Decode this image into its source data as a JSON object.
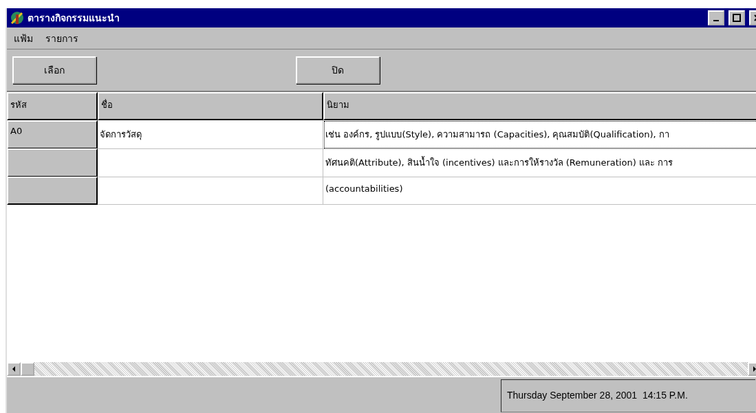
{
  "window": {
    "title": "ตารางกิจกรรมแนะนำ"
  },
  "menu": [
    "แฟ้ม",
    "รายการ"
  ],
  "buttons": [
    "เลือก",
    "ปิด"
  ],
  "table": {
    "columns": [
      "รหัส",
      "ชื่อ",
      "นิยาม"
    ],
    "rows": [
      {
        "code": "A0",
        "name": "จัดการวัสดุ",
        "definition": "เช่น องค์กร, รูปแบบ(Style), ความสามารถ (Capacities), คุณสมบัติ(Qualification), กา",
        "focused": true
      },
      {
        "code": "",
        "name": "",
        "definition": "ทัศนคติ(Attribute), สินน้ำใจ (incentives) และการให้รางวัล (Remuneration) และ การ",
        "focused": false
      },
      {
        "code": "",
        "name": "",
        "definition": "(accountabilities)",
        "focused": false
      }
    ]
  },
  "status_bar": {
    "datetime": "Thursday September 28, 2001  14:15 P.M."
  }
}
